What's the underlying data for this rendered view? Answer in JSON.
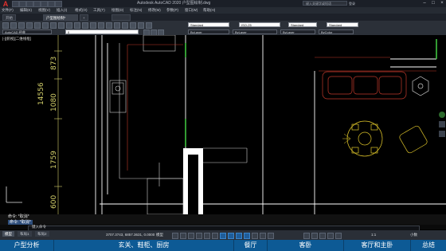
{
  "titlebar": {
    "app_title": "Autodesk AutoCAD 2020  户型图绘制.dwg",
    "search_placeholder": "键入关键字或短语",
    "sign_in": "登录"
  },
  "menu": {
    "items": [
      "文件(F)",
      "编辑(E)",
      "视图(V)",
      "插入(I)",
      "格式(O)",
      "工具(T)",
      "绘图(D)",
      "标注(N)",
      "修改(M)",
      "参数(P)",
      "窗口(W)",
      "帮助(H)"
    ]
  },
  "tabs": {
    "items": [
      "开始",
      "户型图绘制*",
      "+"
    ],
    "active_index": 1
  },
  "toolbar": {
    "workspace": "AutoCAD 经典",
    "layer_value": "0",
    "text_style": "Standard",
    "dim_style": "ISO-25",
    "table_style": "Standard",
    "multileader_style": "Standard",
    "color": "ByLayer",
    "linetype": "ByLayer",
    "lineweight": "ByLayer",
    "plotstyle": "ByColor"
  },
  "drawing": {
    "view_label": "[-][俯视][二维线框]",
    "dim_labels": [
      "873",
      "14556",
      "1080",
      "1759",
      "600"
    ]
  },
  "command": {
    "line1": "命令: *取消*",
    "line2": "命令: *取消*",
    "prompt": "键入命令"
  },
  "status": {
    "layout_tabs": [
      "模型",
      "布局1",
      "布局2"
    ],
    "active_layout": 0,
    "coords": "3707.3743, 6857.3631, 0.0000",
    "model_label": "模型",
    "scale": "1:1",
    "units": "小数"
  },
  "bottomnav": {
    "items": [
      "户型分析",
      "玄关、鞋柜、厨房",
      "餐厅",
      "客卧",
      "客厅和主卧",
      "总结"
    ]
  },
  "colors": {
    "accent_nav": "#0d5a95",
    "wall_white": "#ffffff",
    "furniture_red": "#c0392b",
    "furniture_yellow": "#e0c62a",
    "dimension_yellow": "#d4d06a",
    "green_window": "#3ec43e"
  }
}
